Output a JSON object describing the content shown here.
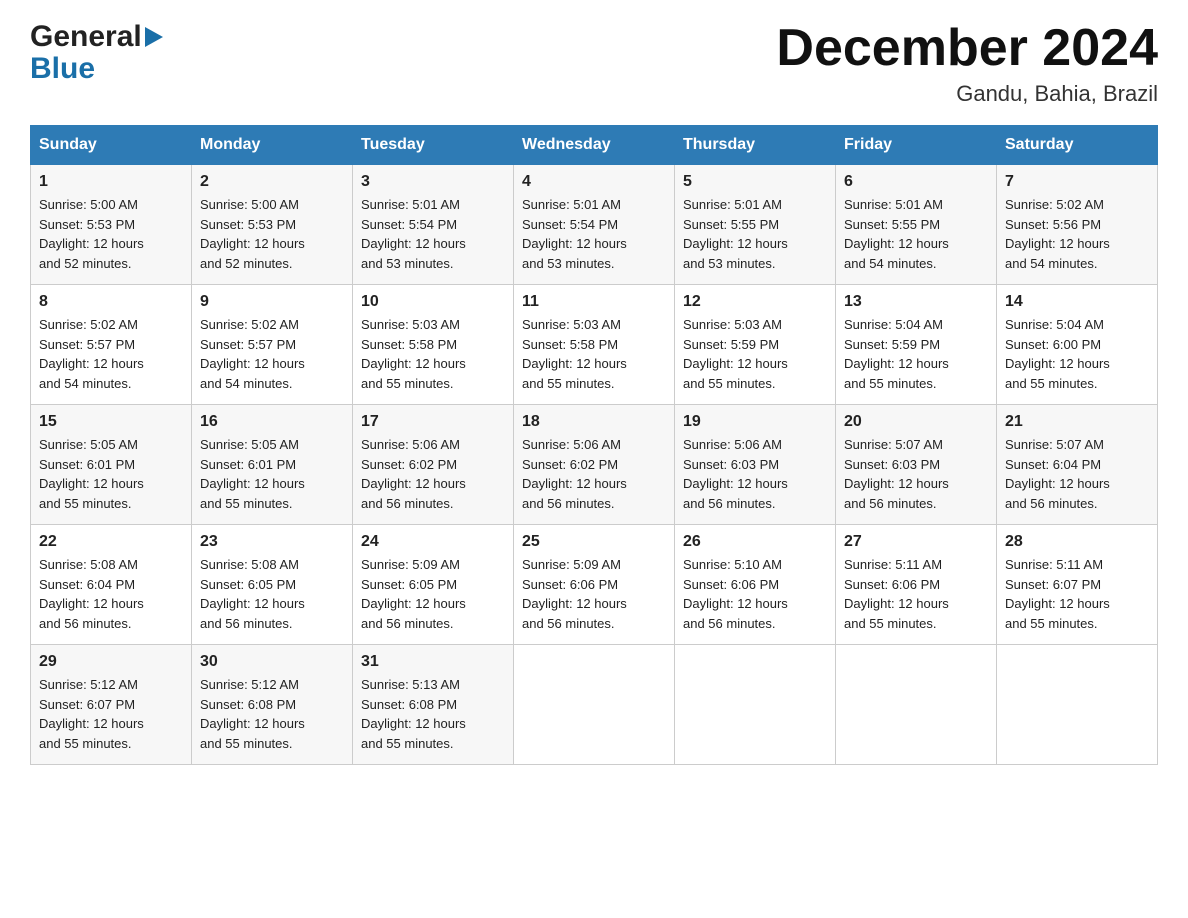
{
  "header": {
    "logo_general": "General",
    "logo_blue": "Blue",
    "month_title": "December 2024",
    "location": "Gandu, Bahia, Brazil"
  },
  "days_of_week": [
    "Sunday",
    "Monday",
    "Tuesday",
    "Wednesday",
    "Thursday",
    "Friday",
    "Saturday"
  ],
  "weeks": [
    [
      {
        "day": "1",
        "sunrise": "5:00 AM",
        "sunset": "5:53 PM",
        "daylight": "12 hours and 52 minutes."
      },
      {
        "day": "2",
        "sunrise": "5:00 AM",
        "sunset": "5:53 PM",
        "daylight": "12 hours and 52 minutes."
      },
      {
        "day": "3",
        "sunrise": "5:01 AM",
        "sunset": "5:54 PM",
        "daylight": "12 hours and 53 minutes."
      },
      {
        "day": "4",
        "sunrise": "5:01 AM",
        "sunset": "5:54 PM",
        "daylight": "12 hours and 53 minutes."
      },
      {
        "day": "5",
        "sunrise": "5:01 AM",
        "sunset": "5:55 PM",
        "daylight": "12 hours and 53 minutes."
      },
      {
        "day": "6",
        "sunrise": "5:01 AM",
        "sunset": "5:55 PM",
        "daylight": "12 hours and 54 minutes."
      },
      {
        "day": "7",
        "sunrise": "5:02 AM",
        "sunset": "5:56 PM",
        "daylight": "12 hours and 54 minutes."
      }
    ],
    [
      {
        "day": "8",
        "sunrise": "5:02 AM",
        "sunset": "5:57 PM",
        "daylight": "12 hours and 54 minutes."
      },
      {
        "day": "9",
        "sunrise": "5:02 AM",
        "sunset": "5:57 PM",
        "daylight": "12 hours and 54 minutes."
      },
      {
        "day": "10",
        "sunrise": "5:03 AM",
        "sunset": "5:58 PM",
        "daylight": "12 hours and 55 minutes."
      },
      {
        "day": "11",
        "sunrise": "5:03 AM",
        "sunset": "5:58 PM",
        "daylight": "12 hours and 55 minutes."
      },
      {
        "day": "12",
        "sunrise": "5:03 AM",
        "sunset": "5:59 PM",
        "daylight": "12 hours and 55 minutes."
      },
      {
        "day": "13",
        "sunrise": "5:04 AM",
        "sunset": "5:59 PM",
        "daylight": "12 hours and 55 minutes."
      },
      {
        "day": "14",
        "sunrise": "5:04 AM",
        "sunset": "6:00 PM",
        "daylight": "12 hours and 55 minutes."
      }
    ],
    [
      {
        "day": "15",
        "sunrise": "5:05 AM",
        "sunset": "6:01 PM",
        "daylight": "12 hours and 55 minutes."
      },
      {
        "day": "16",
        "sunrise": "5:05 AM",
        "sunset": "6:01 PM",
        "daylight": "12 hours and 55 minutes."
      },
      {
        "day": "17",
        "sunrise": "5:06 AM",
        "sunset": "6:02 PM",
        "daylight": "12 hours and 56 minutes."
      },
      {
        "day": "18",
        "sunrise": "5:06 AM",
        "sunset": "6:02 PM",
        "daylight": "12 hours and 56 minutes."
      },
      {
        "day": "19",
        "sunrise": "5:06 AM",
        "sunset": "6:03 PM",
        "daylight": "12 hours and 56 minutes."
      },
      {
        "day": "20",
        "sunrise": "5:07 AM",
        "sunset": "6:03 PM",
        "daylight": "12 hours and 56 minutes."
      },
      {
        "day": "21",
        "sunrise": "5:07 AM",
        "sunset": "6:04 PM",
        "daylight": "12 hours and 56 minutes."
      }
    ],
    [
      {
        "day": "22",
        "sunrise": "5:08 AM",
        "sunset": "6:04 PM",
        "daylight": "12 hours and 56 minutes."
      },
      {
        "day": "23",
        "sunrise": "5:08 AM",
        "sunset": "6:05 PM",
        "daylight": "12 hours and 56 minutes."
      },
      {
        "day": "24",
        "sunrise": "5:09 AM",
        "sunset": "6:05 PM",
        "daylight": "12 hours and 56 minutes."
      },
      {
        "day": "25",
        "sunrise": "5:09 AM",
        "sunset": "6:06 PM",
        "daylight": "12 hours and 56 minutes."
      },
      {
        "day": "26",
        "sunrise": "5:10 AM",
        "sunset": "6:06 PM",
        "daylight": "12 hours and 56 minutes."
      },
      {
        "day": "27",
        "sunrise": "5:11 AM",
        "sunset": "6:06 PM",
        "daylight": "12 hours and 55 minutes."
      },
      {
        "day": "28",
        "sunrise": "5:11 AM",
        "sunset": "6:07 PM",
        "daylight": "12 hours and 55 minutes."
      }
    ],
    [
      {
        "day": "29",
        "sunrise": "5:12 AM",
        "sunset": "6:07 PM",
        "daylight": "12 hours and 55 minutes."
      },
      {
        "day": "30",
        "sunrise": "5:12 AM",
        "sunset": "6:08 PM",
        "daylight": "12 hours and 55 minutes."
      },
      {
        "day": "31",
        "sunrise": "5:13 AM",
        "sunset": "6:08 PM",
        "daylight": "12 hours and 55 minutes."
      },
      null,
      null,
      null,
      null
    ]
  ],
  "labels": {
    "sunrise": "Sunrise:",
    "sunset": "Sunset:",
    "daylight": "Daylight:"
  },
  "colors": {
    "header_bg": "#2e7bb5",
    "header_text": "#ffffff",
    "accent_blue": "#1a6fa8"
  }
}
